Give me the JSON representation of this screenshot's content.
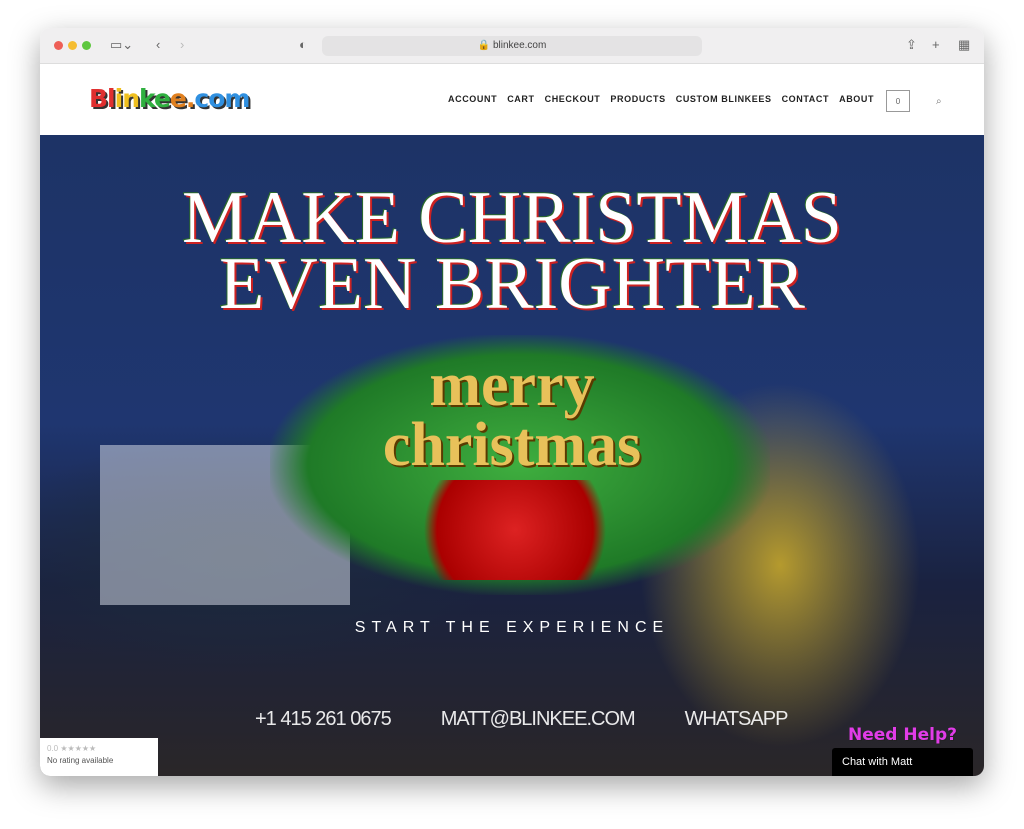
{
  "browser": {
    "url": "blinkee.com"
  },
  "header": {
    "logo": "Blinkee.com",
    "nav": [
      "ACCOUNT",
      "CART",
      "CHECKOUT",
      "PRODUCTS",
      "CUSTOM BLINKEES",
      "CONTACT",
      "ABOUT"
    ],
    "cart_count": "0"
  },
  "hero": {
    "title_line1": "MAKE CHRISTMAS",
    "title_line2": "EVEN BRIGHTER",
    "graphic_line1": "merry",
    "graphic_line2": "christmas",
    "cta": "START THE EXPERIENCE",
    "phone": "+1 415 261 0675",
    "email": "MATT@BLINKEE.COM",
    "whatsapp": "WHATSAPP"
  },
  "rating": {
    "score": "0.0 ★★★★★",
    "text": "No rating available"
  },
  "chat": {
    "prompt": "Need Help?",
    "button": "Chat with Matt"
  }
}
